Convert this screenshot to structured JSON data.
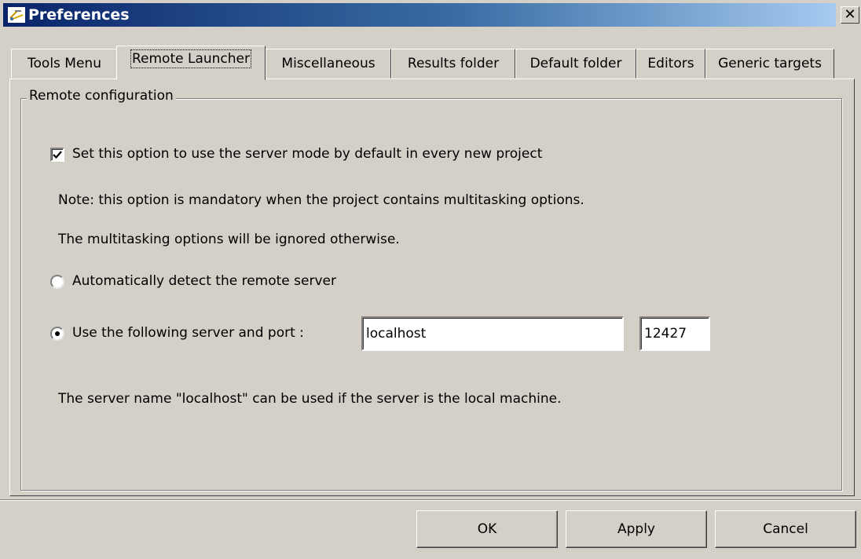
{
  "window": {
    "title": "Preferences",
    "close_label": "✕"
  },
  "tabs": [
    "Tools Menu",
    "Remote Launcher",
    "Miscellaneous",
    "Results folder",
    "Default folder",
    "Editors",
    "Generic targets"
  ],
  "active_tab_index": 1,
  "group": {
    "legend": "Remote configuration",
    "server_mode_checkbox": {
      "label": "Set this option to use the server mode by default in every new project",
      "checked": true
    },
    "note_line1": "Note: this option is mandatory when the project contains multitasking options.",
    "note_line2": "The multitasking options will be ignored otherwise.",
    "radio_auto": {
      "label": "Automatically detect the remote server",
      "selected": false
    },
    "radio_manual": {
      "label": "Use the following server and port :",
      "selected": true
    },
    "server_field": {
      "value": "localhost"
    },
    "port_field": {
      "value": "12427"
    },
    "hint": "The server name \"localhost\" can be used if the server is the local machine."
  },
  "buttons": {
    "ok": "OK",
    "apply": "Apply",
    "cancel": "Cancel"
  }
}
